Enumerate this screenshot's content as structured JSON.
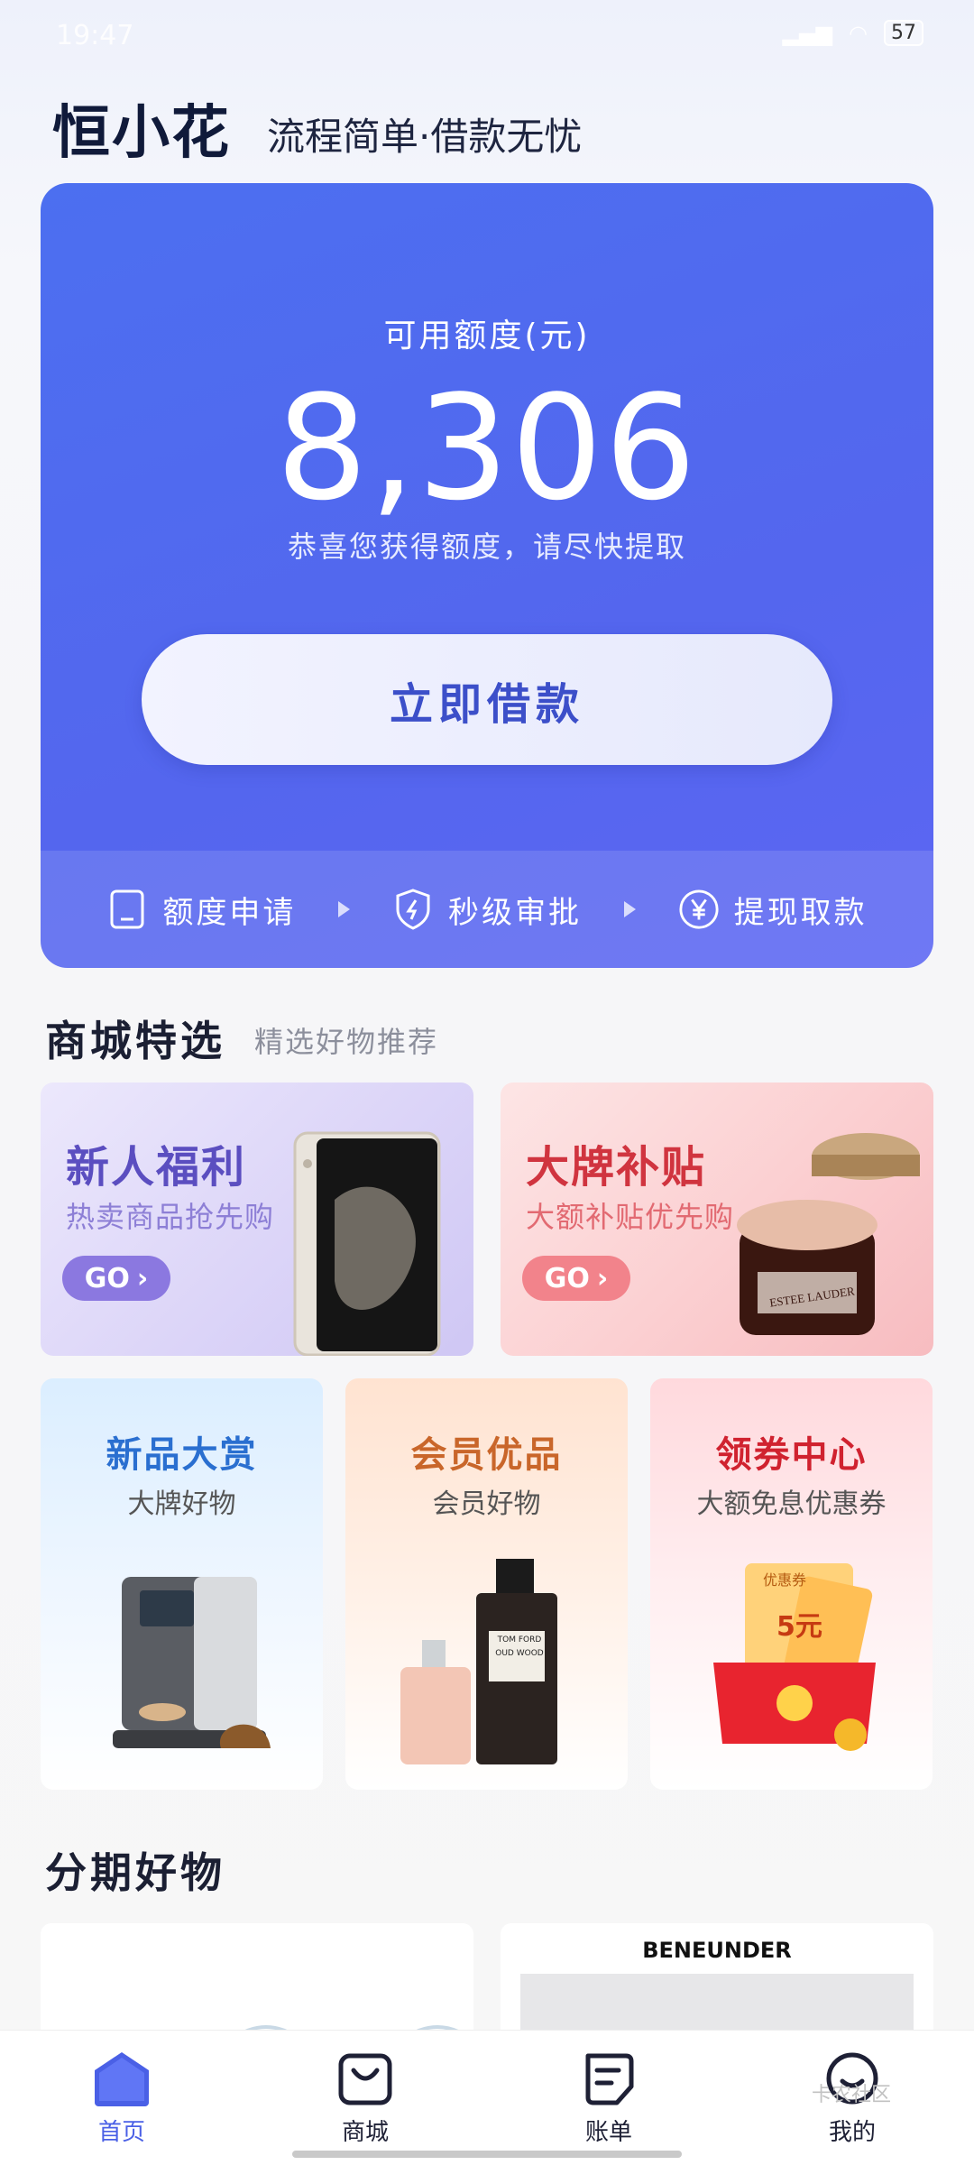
{
  "status_bar": {
    "time": "19:47",
    "battery": "57"
  },
  "header": {
    "brand": "恒小花",
    "slogan": "流程简单·借款无忧"
  },
  "credit": {
    "label": "可用额度(元)",
    "amount": "8,306",
    "tip": "恭喜您获得额度，请尽快提取",
    "button": "立即借款",
    "steps": [
      "额度申请",
      "秒级审批",
      "提现取款"
    ]
  },
  "mall": {
    "title": "商城特选",
    "subtitle": "精选好物推荐",
    "big_tiles": [
      {
        "title": "新人福利",
        "subtitle": "热卖商品抢先购",
        "cta": "GO"
      },
      {
        "title": "大牌补贴",
        "subtitle": "大额补贴优先购",
        "cta": "GO"
      }
    ],
    "small_tiles": [
      {
        "title": "新品大赏",
        "subtitle": "大牌好物"
      },
      {
        "title": "会员优品",
        "subtitle": "会员好物"
      },
      {
        "title": "领券中心",
        "subtitle": "大额免息优惠券"
      }
    ],
    "product_labels": {
      "jar": "ESTEE LAUDER",
      "perfume": "TOM FORD",
      "perfume_sub": "OUD WOOD",
      "coupon": "优惠券",
      "coupon_value": "5元"
    }
  },
  "installment": {
    "title": "分期好物",
    "products": [
      {
        "brand": ""
      },
      {
        "brand": "BENEUNDER"
      }
    ]
  },
  "bottom_nav": [
    {
      "label": "首页",
      "icon": "home-icon",
      "active": true
    },
    {
      "label": "商城",
      "icon": "shopping-bag-icon",
      "active": false
    },
    {
      "label": "账单",
      "icon": "bill-icon",
      "active": false
    },
    {
      "label": "我的",
      "icon": "profile-icon",
      "active": false
    }
  ],
  "watermark": "卡农社区",
  "colors": {
    "accent": "#4a60e6",
    "card": "#5468ef",
    "promo_purple": "#5b4ec0",
    "promo_red": "#d0343f",
    "tile_blue": "#2a6fd0",
    "tile_orange": "#c9662a",
    "tile_red": "#d0222f"
  }
}
